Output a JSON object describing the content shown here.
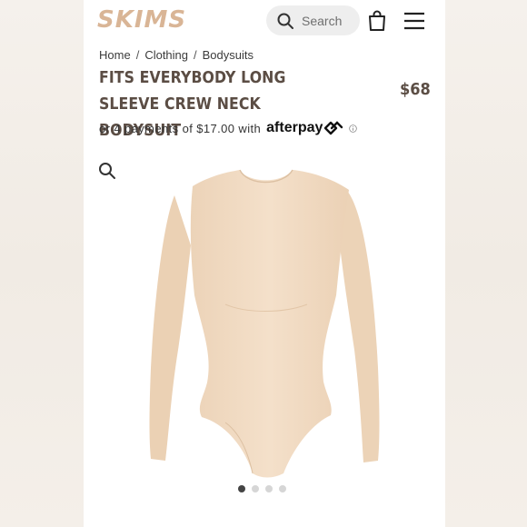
{
  "header": {
    "logo": "SKIMS",
    "search_label": "Search"
  },
  "breadcrumb": [
    "Home",
    "Clothing",
    "Bodysuits"
  ],
  "product": {
    "title": "FITS EVERYBODY LONG SLEEVE CREW NECK BODYSUIT",
    "price": "$68",
    "installment_text": "or 4 payments of $17.00 with",
    "payment_brand": "afterpay"
  },
  "gallery": {
    "dot_count": 4,
    "active_index": 0
  },
  "colors": {
    "brand": "#d9b596",
    "text_dark": "#5b4d44",
    "product_fill": "#f2dcc3"
  }
}
